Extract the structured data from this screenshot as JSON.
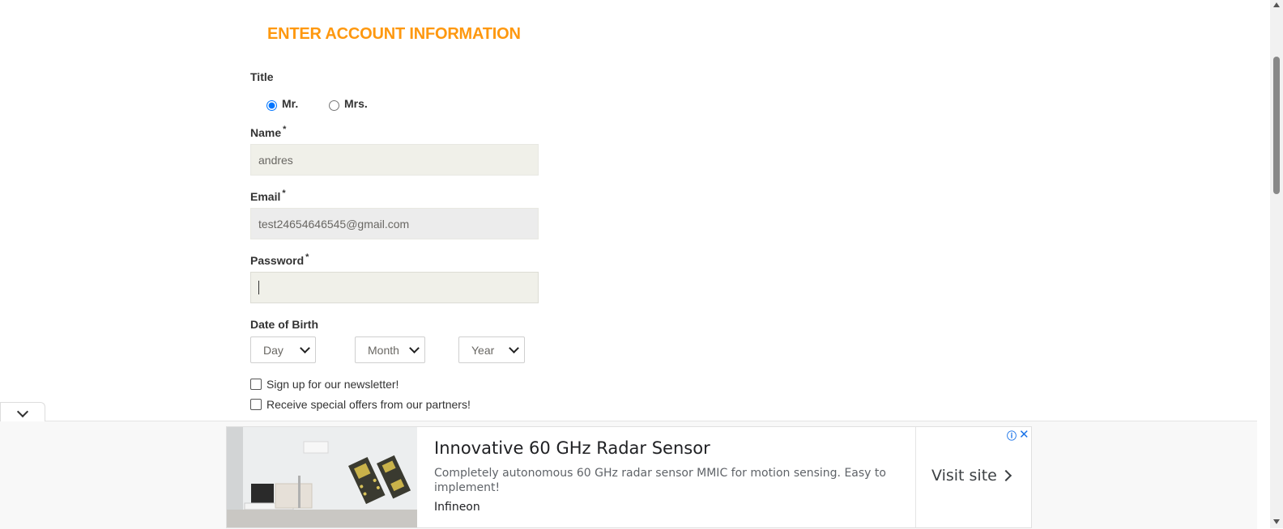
{
  "form": {
    "heading": "ENTER ACCOUNT INFORMATION",
    "title_label": "Title",
    "title_options": [
      "Mr.",
      "Mrs."
    ],
    "title_selected": "Mr.",
    "name_label": "Name",
    "name_value": "andres",
    "email_label": "Email",
    "email_value": "test24654646545@gmail.com",
    "password_label": "Password",
    "password_value": "",
    "required_mark": "*",
    "dob_label": "Date of Birth",
    "dob_day": "Day",
    "dob_month": "Month",
    "dob_year": "Year",
    "newsletter_label": "Sign up for our newsletter!",
    "offers_label": "Receive special offers from our partners!"
  },
  "ad": {
    "title": "Innovative 60 GHz Radar Sensor",
    "description": "Completely autonomous 60 GHz radar sensor MMIC for motion sensing. Easy to implement!",
    "brand": "Infineon",
    "cta": "Visit site",
    "info_icon": "info-icon",
    "close_icon": "close-icon"
  },
  "colors": {
    "heading": "#fe980f",
    "input_bg": "#f0f0e9"
  }
}
